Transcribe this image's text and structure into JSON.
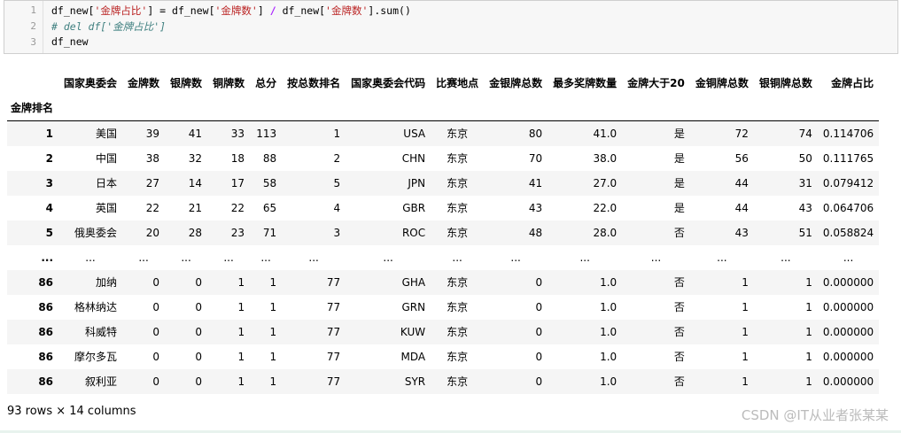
{
  "code": {
    "line_numbers": [
      "1",
      "2",
      "3"
    ],
    "line1": {
      "a": "df_new[",
      "b": "'金牌占比'",
      "c": "] = df_new[",
      "d": "'金牌数'",
      "e": "] ",
      "f": "/",
      "g": " df_new[",
      "h": "'金牌数'",
      "i": "].sum()"
    },
    "line2": "# del df['金牌占比']",
    "line3": "df_new"
  },
  "table": {
    "columns": [
      "国家奥委会",
      "金牌数",
      "银牌数",
      "铜牌数",
      "总分",
      "按总数排名",
      "国家奥委会代码",
      "比赛地点",
      "金银牌总数",
      "最多奖牌数量",
      "金牌大于20",
      "金铜牌总数",
      "银铜牌总数",
      "金牌占比"
    ],
    "index_name": "金牌排名",
    "rows": [
      {
        "idx": "1",
        "cells": [
          "美国",
          "39",
          "41",
          "33",
          "113",
          "1",
          "USA",
          "东京",
          "80",
          "41.0",
          "是",
          "72",
          "74",
          "0.114706"
        ]
      },
      {
        "idx": "2",
        "cells": [
          "中国",
          "38",
          "32",
          "18",
          "88",
          "2",
          "CHN",
          "东京",
          "70",
          "38.0",
          "是",
          "56",
          "50",
          "0.111765"
        ]
      },
      {
        "idx": "3",
        "cells": [
          "日本",
          "27",
          "14",
          "17",
          "58",
          "5",
          "JPN",
          "东京",
          "41",
          "27.0",
          "是",
          "44",
          "31",
          "0.079412"
        ]
      },
      {
        "idx": "4",
        "cells": [
          "英国",
          "22",
          "21",
          "22",
          "65",
          "4",
          "GBR",
          "东京",
          "43",
          "22.0",
          "是",
          "44",
          "43",
          "0.064706"
        ]
      },
      {
        "idx": "5",
        "cells": [
          "俄奥委会",
          "20",
          "28",
          "23",
          "71",
          "3",
          "ROC",
          "东京",
          "48",
          "28.0",
          "否",
          "43",
          "51",
          "0.058824"
        ]
      },
      {
        "idx": "...",
        "cells": [
          "...",
          "...",
          "...",
          "...",
          "...",
          "...",
          "...",
          "...",
          "...",
          "...",
          "...",
          "...",
          "...",
          "..."
        ]
      },
      {
        "idx": "86",
        "cells": [
          "加纳",
          "0",
          "0",
          "1",
          "1",
          "77",
          "GHA",
          "东京",
          "0",
          "1.0",
          "否",
          "1",
          "1",
          "0.000000"
        ]
      },
      {
        "idx": "86",
        "cells": [
          "格林纳达",
          "0",
          "0",
          "1",
          "1",
          "77",
          "GRN",
          "东京",
          "0",
          "1.0",
          "否",
          "1",
          "1",
          "0.000000"
        ]
      },
      {
        "idx": "86",
        "cells": [
          "科威特",
          "0",
          "0",
          "1",
          "1",
          "77",
          "KUW",
          "东京",
          "0",
          "1.0",
          "否",
          "1",
          "1",
          "0.000000"
        ]
      },
      {
        "idx": "86",
        "cells": [
          "摩尔多瓦",
          "0",
          "0",
          "1",
          "1",
          "77",
          "MDA",
          "东京",
          "0",
          "1.0",
          "否",
          "1",
          "1",
          "0.000000"
        ]
      },
      {
        "idx": "86",
        "cells": [
          "叙利亚",
          "0",
          "0",
          "1",
          "1",
          "77",
          "SYR",
          "东京",
          "0",
          "1.0",
          "否",
          "1",
          "1",
          "0.000000"
        ]
      }
    ]
  },
  "rows_info": "93 rows × 14 columns",
  "watermark": "CSDN @IT从业者张某某",
  "colors": {
    "string": "#ba2121",
    "operator": "#aa22ff",
    "comment": "#408080",
    "row_stripe": "#f5f5f5"
  }
}
